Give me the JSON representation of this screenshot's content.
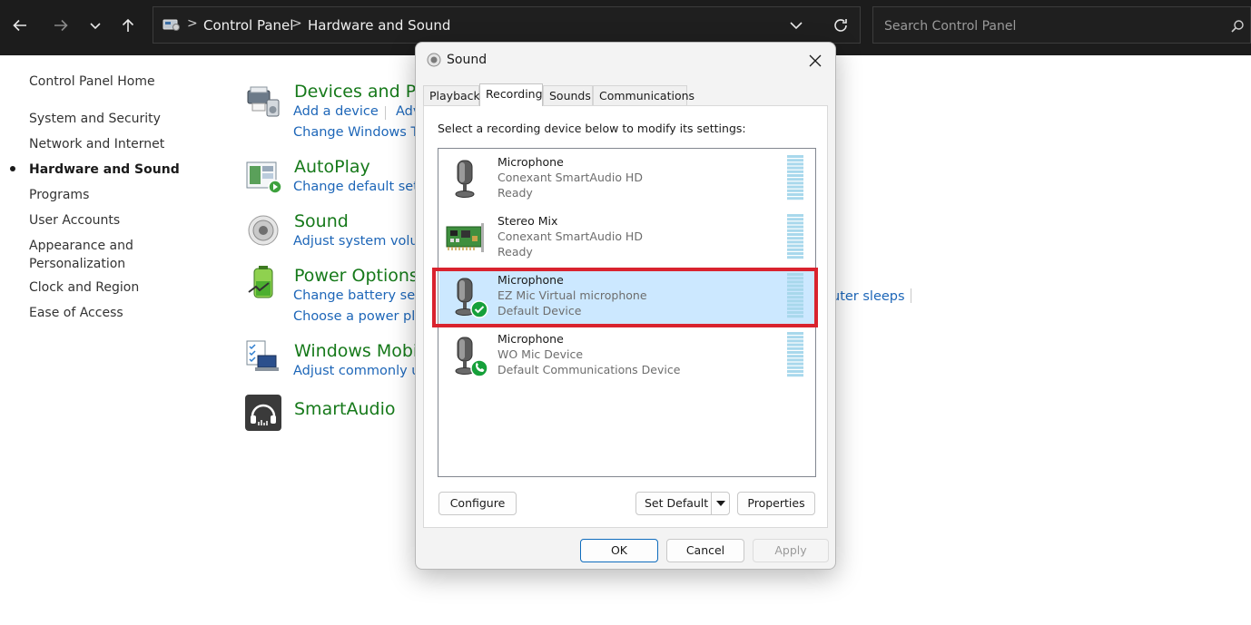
{
  "toolbar": {
    "breadcrumb": [
      "Control Panel",
      "Hardware and Sound"
    ],
    "search_placeholder": "Search Control Panel"
  },
  "sidebar": {
    "items": [
      {
        "label": "Control Panel Home"
      },
      {
        "label": "System and Security"
      },
      {
        "label": "Network and Internet"
      },
      {
        "label": "Hardware and Sound",
        "active": true
      },
      {
        "label": "Programs"
      },
      {
        "label": "User Accounts"
      },
      {
        "label": "Appearance and"
      },
      {
        "label": "Personalization"
      },
      {
        "label": "Clock and Region"
      },
      {
        "label": "Ease of Access"
      }
    ]
  },
  "categories": [
    {
      "title": "Devices and Pri",
      "links": [
        "Add a device",
        "Adv",
        "Change Windows To"
      ],
      "icon": "devices-printers-icon"
    },
    {
      "title": "AutoPlay",
      "links": [
        "Change default setti"
      ],
      "icon": "autoplay-icon"
    },
    {
      "title": "Sound",
      "links": [
        "Adjust system volum"
      ],
      "icon": "speaker-icon"
    },
    {
      "title": "Power Options",
      "links": [
        "Change battery setti",
        "Choose a power plan",
        "uter sleeps"
      ],
      "icon": "battery-icon"
    },
    {
      "title": "Windows Mobi",
      "links": [
        "Adjust commonly us"
      ],
      "icon": "mobility-center-icon"
    },
    {
      "title": "SmartAudio",
      "links": [],
      "icon": "headphones-icon"
    }
  ],
  "dialog": {
    "title": "Sound",
    "tabs": [
      "Playback",
      "Recording",
      "Sounds",
      "Communications"
    ],
    "selected_tab": "Recording",
    "instruction": "Select a recording device below to modify its settings:",
    "devices": [
      {
        "name": "Microphone",
        "driver": "Conexant SmartAudio HD",
        "status": "Ready",
        "icon": "microphone-icon"
      },
      {
        "name": "Stereo Mix",
        "driver": "Conexant SmartAudio HD",
        "status": "Ready",
        "icon": "sound-card-icon"
      },
      {
        "name": "Microphone",
        "driver": "EZ Mic Virtual microphone",
        "status": "Default Device",
        "icon": "microphone-default-icon",
        "selected": true
      },
      {
        "name": "Microphone",
        "driver": "WO Mic Device",
        "status": "Default Communications Device",
        "icon": "microphone-communications-icon"
      }
    ],
    "buttons": {
      "configure": "Configure",
      "set_default": "Set Default",
      "properties": "Properties",
      "ok": "OK",
      "cancel": "Cancel",
      "apply": "Apply"
    },
    "colors": {
      "highlight_border": "#d9232e",
      "selected_row": "#cce8ff",
      "category_title": "#16791a",
      "link": "#1d66b8"
    }
  }
}
